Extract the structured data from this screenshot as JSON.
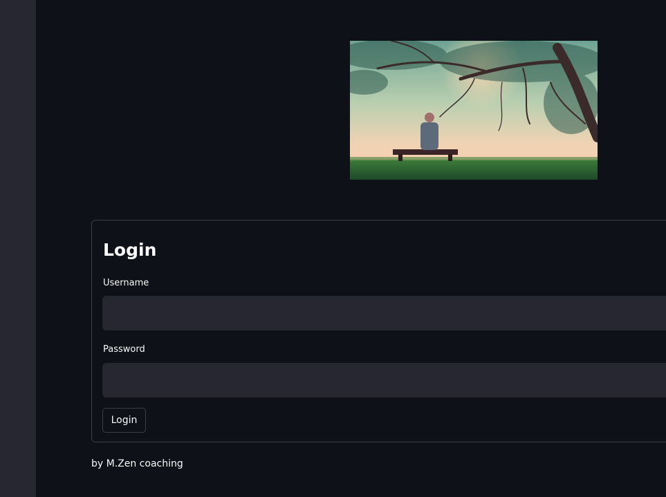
{
  "hero": {
    "icon": "photo-tree-bench"
  },
  "login": {
    "title": "Login",
    "username_label": "Username",
    "username_value": "",
    "password_label": "Password",
    "password_value": "",
    "submit_label": "Login"
  },
  "footer": {
    "text": "by M.Zen coaching"
  },
  "colors": {
    "background": "#0e1117",
    "sidebar": "#262730",
    "input_background": "#262730",
    "text": "#fafafa"
  }
}
